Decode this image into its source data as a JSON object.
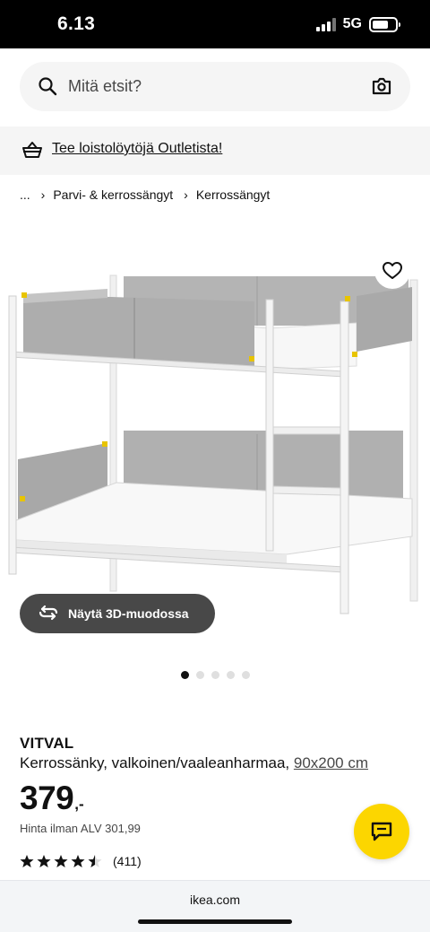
{
  "status": {
    "time": "6.13",
    "network": "5G",
    "battery_level": 0.72
  },
  "search": {
    "placeholder": "Mitä etsit?",
    "icon": "search-icon",
    "camera_icon": "camera-icon"
  },
  "promo": {
    "icon": "basket-icon",
    "link_text": "Tee loistolöytöjä Outletista!"
  },
  "breadcrumb": {
    "items": [
      "...",
      "Parvi- & kerrossängyt",
      "Kerrossängyt"
    ]
  },
  "gallery": {
    "image_alt": "bunk-bed-image",
    "favorite_icon": "heart-icon",
    "view_3d_label": "Näytä 3D-muodossa",
    "dot_count": 5,
    "active_dot": 0
  },
  "product": {
    "name": "VITVAL",
    "description": "Kerrossänky, valkoinen/vaaleanharmaa, ",
    "size": "90x200 cm",
    "price": "379",
    "price_suffix": ",-",
    "price_vat": "Hinta ilman ALV 301,99",
    "rating": 4.5,
    "review_count": "(411)"
  },
  "colors": {
    "accent": "#fcd600",
    "dark_button": "#484848",
    "surface": "#f5f5f5"
  },
  "footer": {
    "url": "ikea.com"
  }
}
